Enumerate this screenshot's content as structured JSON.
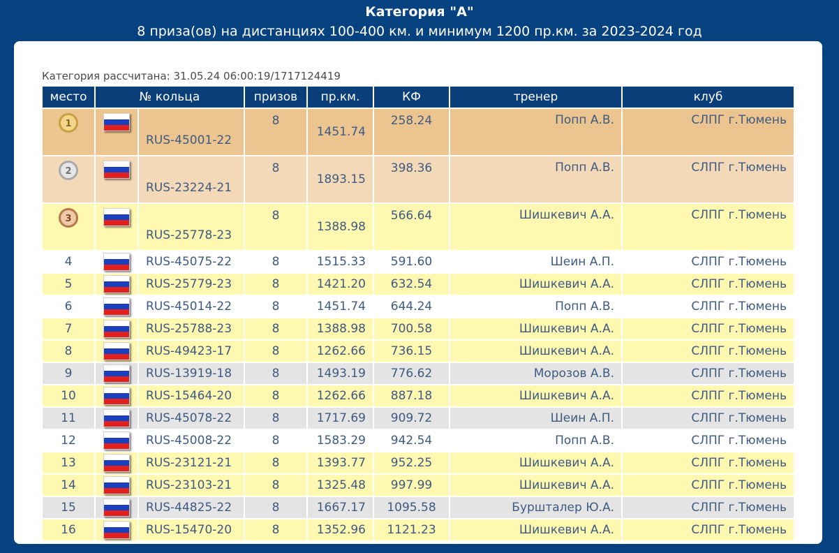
{
  "header": {
    "title": "Категория \"А\"",
    "subtitle": "8 приза(ов) на дистанциях 100-400 км. и минимум 1200 пр.км. за 2023-2024 год"
  },
  "calc_label": "Категория рассчитана: 31.05.24 06:00:19/1717124419",
  "columns": [
    "место",
    "№ кольца",
    "призов",
    "пр.км.",
    "КФ",
    "тренер",
    "клуб"
  ],
  "rows": [
    {
      "place": "1",
      "medal": "gold",
      "ring": "RUS-45001-22",
      "prizes": "8",
      "km": "1451.74",
      "kf": "258.24",
      "trainer": "Попп А.В.",
      "club": "СЛПГ г.Тюмень",
      "style": "gold"
    },
    {
      "place": "2",
      "medal": "silver",
      "ring": "RUS-23224-21",
      "prizes": "8",
      "km": "1893.15",
      "kf": "398.36",
      "trainer": "Попп А.В.",
      "club": "СЛПГ г.Тюмень",
      "style": "silver"
    },
    {
      "place": "3",
      "medal": "bronze",
      "ring": "RUS-25778-23",
      "prizes": "8",
      "km": "1388.98",
      "kf": "566.64",
      "trainer": "Шишкевич А.А.",
      "club": "СЛПГ г.Тюмень",
      "style": "yellow"
    },
    {
      "place": "4",
      "ring": "RUS-45075-22",
      "prizes": "8",
      "km": "1515.33",
      "kf": "591.60",
      "trainer": "Шеин А.П.",
      "club": "СЛПГ г.Тюмень",
      "style": "white"
    },
    {
      "place": "5",
      "ring": "RUS-25779-23",
      "prizes": "8",
      "km": "1421.20",
      "kf": "632.54",
      "trainer": "Шишкевич А.А.",
      "club": "СЛПГ г.Тюмень",
      "style": "yellow"
    },
    {
      "place": "6",
      "ring": "RUS-45014-22",
      "prizes": "8",
      "km": "1451.74",
      "kf": "644.24",
      "trainer": "Попп А.В.",
      "club": "СЛПГ г.Тюмень",
      "style": "white"
    },
    {
      "place": "7",
      "ring": "RUS-25788-23",
      "prizes": "8",
      "km": "1388.98",
      "kf": "700.58",
      "trainer": "Шишкевич А.А.",
      "club": "СЛПГ г.Тюмень",
      "style": "yellow"
    },
    {
      "place": "8",
      "ring": "RUS-49423-17",
      "prizes": "8",
      "km": "1262.66",
      "kf": "736.15",
      "trainer": "Шишкевич А.А.",
      "club": "СЛПГ г.Тюмень",
      "style": "yellow"
    },
    {
      "place": "9",
      "ring": "RUS-13919-18",
      "prizes": "8",
      "km": "1493.19",
      "kf": "776.62",
      "trainer": "Морозов А.В.",
      "club": "СЛПГ г.Тюмень",
      "style": "gray"
    },
    {
      "place": "10",
      "ring": "RUS-15464-20",
      "prizes": "8",
      "km": "1262.66",
      "kf": "887.18",
      "trainer": "Шишкевич А.А.",
      "club": "СЛПГ г.Тюмень",
      "style": "yellow"
    },
    {
      "place": "11",
      "ring": "RUS-45078-22",
      "prizes": "8",
      "km": "1717.69",
      "kf": "909.72",
      "trainer": "Шеин А.П.",
      "club": "СЛПГ г.Тюмень",
      "style": "gray"
    },
    {
      "place": "12",
      "ring": "RUS-45008-22",
      "prizes": "8",
      "km": "1583.29",
      "kf": "942.54",
      "trainer": "Попп А.В.",
      "club": "СЛПГ г.Тюмень",
      "style": "white"
    },
    {
      "place": "13",
      "ring": "RUS-23121-21",
      "prizes": "8",
      "km": "1393.77",
      "kf": "952.25",
      "trainer": "Шишкевич А.А.",
      "club": "СЛПГ г.Тюмень",
      "style": "yellow"
    },
    {
      "place": "14",
      "ring": "RUS-23103-21",
      "prizes": "8",
      "km": "1325.48",
      "kf": "997.99",
      "trainer": "Шишкевич А.А.",
      "club": "СЛПГ г.Тюмень",
      "style": "yellow"
    },
    {
      "place": "15",
      "ring": "RUS-44825-22",
      "prizes": "8",
      "km": "1667.17",
      "kf": "1095.58",
      "trainer": "Бурш­талер Ю.А.",
      "club": "СЛПГ г.Тюмень",
      "style": "gray"
    },
    {
      "place": "16",
      "ring": "RUS-15470-20",
      "prizes": "8",
      "km": "1352.96",
      "kf": "1121.23",
      "trainer": "Шишкевич А.А.",
      "club": "СЛПГ г.Тюмень",
      "style": "yellow"
    }
  ],
  "colors": {
    "page_background": "#06427f",
    "header_cell": "#0a3f7a",
    "row_gold": "#ecc48f",
    "row_silver": "#f4d9b8",
    "row_yellow": "#fff8b0",
    "row_gray": "#e4e4e4",
    "text": "#3d5a80"
  },
  "icons": {
    "flag": "russia-flag-icon",
    "medals": [
      "gold-medal-icon",
      "silver-medal-icon",
      "bronze-medal-icon"
    ]
  }
}
